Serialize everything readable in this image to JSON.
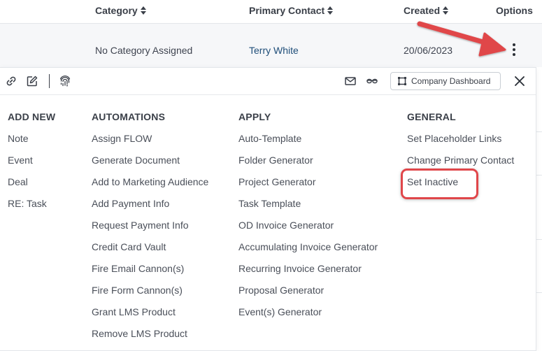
{
  "table": {
    "headers": [
      "Category",
      "Primary Contact",
      "Created",
      "Options"
    ],
    "row": {
      "category": "No Category Assigned",
      "primary_contact": "Terry White",
      "created": "20/06/2023"
    }
  },
  "toolbar": {
    "icons": [
      "link-icon",
      "edit-icon",
      "fingerprint-icon",
      "mail-icon",
      "glasses-icon",
      "dashboard-icon",
      "close-icon"
    ],
    "dashboard_label": "Company Dashboard"
  },
  "menu": {
    "add_new": {
      "title": "ADD NEW",
      "items": [
        "Note",
        "Event",
        "Deal",
        "RE: Task"
      ]
    },
    "automations": {
      "title": "AUTOMATIONS",
      "items": [
        "Assign FLOW",
        "Generate Document",
        "Add to Marketing Audience",
        "Add Payment Info",
        "Request Payment Info",
        "Credit Card Vault",
        "Fire Email Cannon(s)",
        "Fire Form Cannon(s)",
        "Grant LMS Product",
        "Remove LMS Product"
      ]
    },
    "apply": {
      "title": "APPLY",
      "items": [
        "Auto-Template",
        "Folder Generator",
        "Project Generator",
        "Task Template",
        "OD Invoice Generator",
        "Accumulating Invoice Generator",
        "Recurring Invoice Generator",
        "Proposal Generator",
        "Event(s) Generator"
      ]
    },
    "general": {
      "title": "GENERAL",
      "items": [
        "Set Placeholder Links",
        "Change Primary Contact",
        "Set Inactive"
      ]
    }
  },
  "colors": {
    "annotation": "#e0464a",
    "link": "#1f4e79",
    "text": "#4a4f59"
  }
}
